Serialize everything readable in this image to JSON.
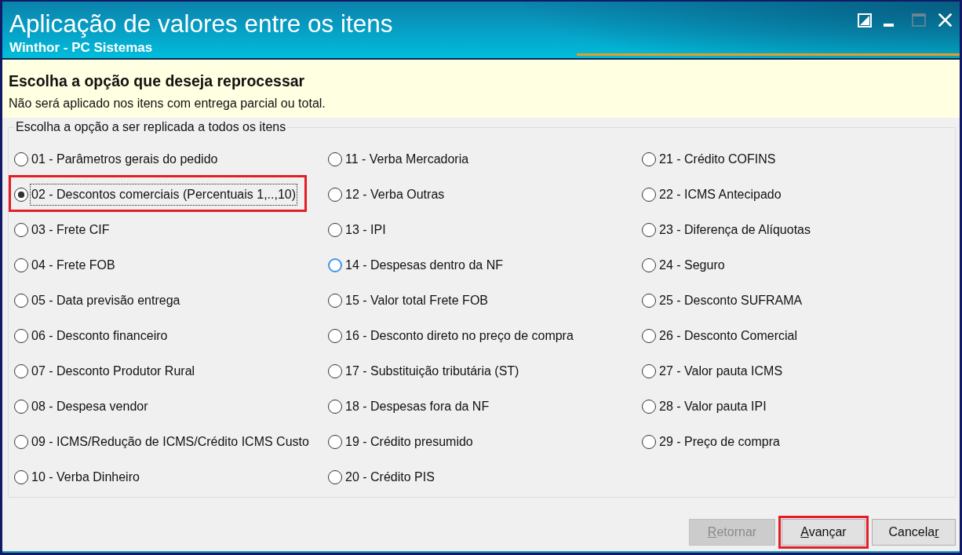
{
  "window": {
    "title": "Aplicação de valores entre os itens",
    "app_name": "Winthor - PC Sistemas",
    "maximize_disabled": true
  },
  "header": {
    "heading": "Escolha a opção que deseja reprocessar",
    "note": "Não será aplicado nos itens com entrega parcial ou total."
  },
  "group": {
    "label": "Escolha a opção a ser replicada a todos os itens",
    "options": [
      {
        "label": "01 - Parâmetros gerais do pedido",
        "selected": false,
        "hovered": false,
        "highlighted": false
      },
      {
        "label": "02 - Descontos comerciais (Percentuais 1,..,10)",
        "selected": true,
        "hovered": false,
        "highlighted": true
      },
      {
        "label": "03 - Frete CIF",
        "selected": false,
        "hovered": false,
        "highlighted": false
      },
      {
        "label": "04 - Frete FOB",
        "selected": false,
        "hovered": false,
        "highlighted": false
      },
      {
        "label": "05 - Data previsão entrega",
        "selected": false,
        "hovered": false,
        "highlighted": false
      },
      {
        "label": "06 - Desconto financeiro",
        "selected": false,
        "hovered": false,
        "highlighted": false
      },
      {
        "label": "07 - Desconto Produtor Rural",
        "selected": false,
        "hovered": false,
        "highlighted": false
      },
      {
        "label": "08 - Despesa vendor",
        "selected": false,
        "hovered": false,
        "highlighted": false
      },
      {
        "label": "09 - ICMS/Redução de ICMS/Crédito ICMS Custo",
        "selected": false,
        "hovered": false,
        "highlighted": false
      },
      {
        "label": "10 - Verba Dinheiro",
        "selected": false,
        "hovered": false,
        "highlighted": false
      },
      {
        "label": "11 - Verba Mercadoria",
        "selected": false,
        "hovered": false,
        "highlighted": false
      },
      {
        "label": "12 - Verba Outras",
        "selected": false,
        "hovered": false,
        "highlighted": false
      },
      {
        "label": "13 - IPI",
        "selected": false,
        "hovered": false,
        "highlighted": false
      },
      {
        "label": "14 - Despesas dentro da NF",
        "selected": false,
        "hovered": true,
        "highlighted": false
      },
      {
        "label": "15 - Valor total Frete FOB",
        "selected": false,
        "hovered": false,
        "highlighted": false
      },
      {
        "label": "16 - Desconto direto no preço de compra",
        "selected": false,
        "hovered": false,
        "highlighted": false
      },
      {
        "label": "17 - Substituição tributária (ST)",
        "selected": false,
        "hovered": false,
        "highlighted": false
      },
      {
        "label": "18 - Despesas fora da NF",
        "selected": false,
        "hovered": false,
        "highlighted": false
      },
      {
        "label": "19 - Crédito presumido",
        "selected": false,
        "hovered": false,
        "highlighted": false
      },
      {
        "label": "20 - Crédito PIS",
        "selected": false,
        "hovered": false,
        "highlighted": false
      },
      {
        "label": "21 - Crédito COFINS",
        "selected": false,
        "hovered": false,
        "highlighted": false
      },
      {
        "label": "22 - ICMS Antecipado",
        "selected": false,
        "hovered": false,
        "highlighted": false
      },
      {
        "label": "23 - Diferença de Alíquotas",
        "selected": false,
        "hovered": false,
        "highlighted": false
      },
      {
        "label": "24 - Seguro",
        "selected": false,
        "hovered": false,
        "highlighted": false
      },
      {
        "label": "25 - Desconto SUFRAMA",
        "selected": false,
        "hovered": false,
        "highlighted": false
      },
      {
        "label": "26 - Desconto Comercial",
        "selected": false,
        "hovered": false,
        "highlighted": false
      },
      {
        "label": "27 - Valor pauta ICMS",
        "selected": false,
        "hovered": false,
        "highlighted": false
      },
      {
        "label": "28 - Valor pauta IPI",
        "selected": false,
        "hovered": false,
        "highlighted": false
      },
      {
        "label": "29 - Preço de compra",
        "selected": false,
        "hovered": false,
        "highlighted": false
      }
    ]
  },
  "buttons": [
    {
      "label_segments": [
        {
          "text": "R",
          "underline": true
        },
        {
          "text": "etornar",
          "underline": false
        }
      ],
      "disabled": true,
      "highlighted": false
    },
    {
      "label_segments": [
        {
          "text": "A",
          "underline": true
        },
        {
          "text": "vançar",
          "underline": false
        }
      ],
      "disabled": false,
      "highlighted": true
    },
    {
      "label_segments": [
        {
          "text": "Cancela",
          "underline": false
        },
        {
          "text": "r",
          "underline": true
        }
      ],
      "disabled": false,
      "highlighted": false
    }
  ]
}
